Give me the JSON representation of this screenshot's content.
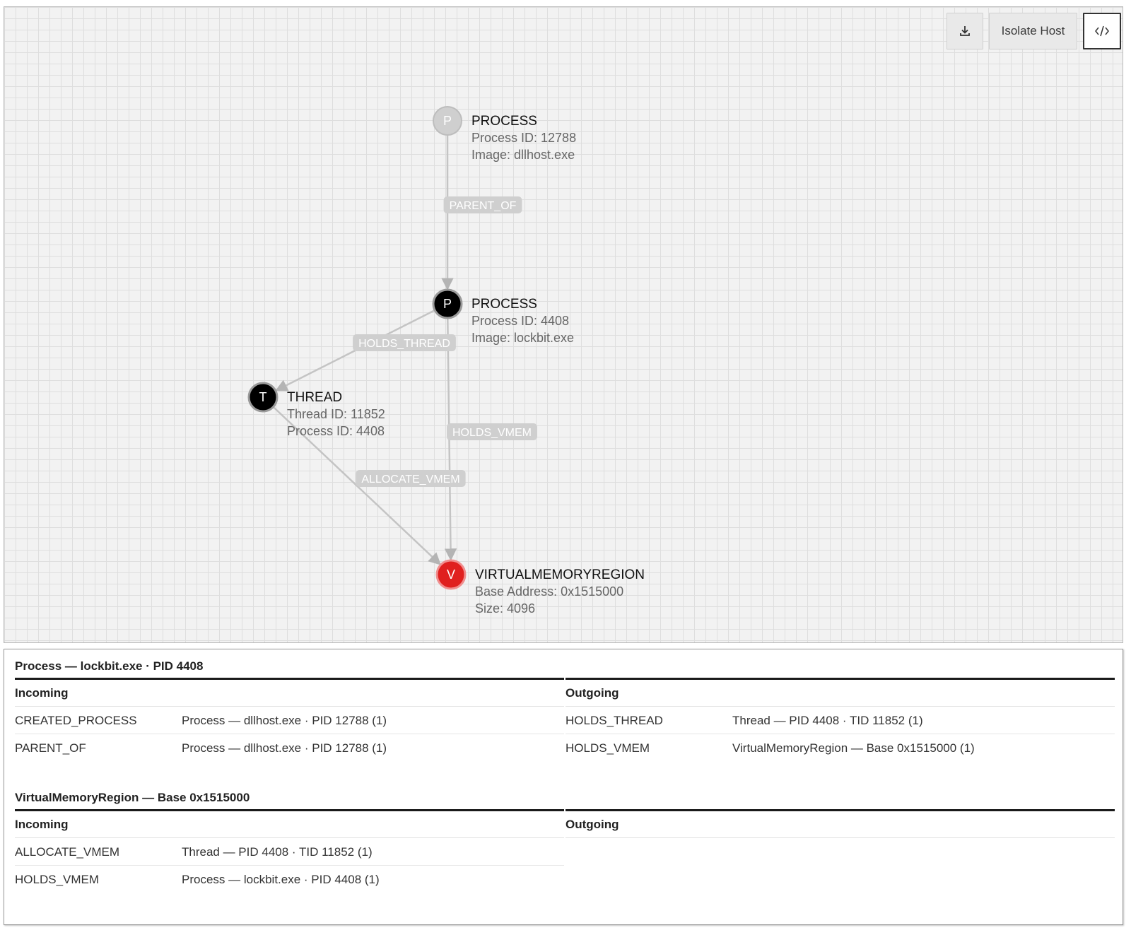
{
  "toolbar": {
    "download_icon": "download-icon",
    "isolate_label": "Isolate Host",
    "code_icon": "code-icon"
  },
  "graph": {
    "nodes": [
      {
        "id": "p1",
        "letter": "P",
        "type": "PROCESS",
        "line1": "Process ID: 12788",
        "line2": "Image: dllhost.exe",
        "color": "#cfcfcf"
      },
      {
        "id": "p2",
        "letter": "P",
        "type": "PROCESS",
        "line1": "Process ID: 4408",
        "line2": "Image: lockbit.exe",
        "color": "#000000"
      },
      {
        "id": "t1",
        "letter": "T",
        "type": "THREAD",
        "line1": "Thread ID: 11852",
        "line2": "Process ID: 4408",
        "color": "#000000"
      },
      {
        "id": "v1",
        "letter": "V",
        "type": "VIRTUALMEMORYREGION",
        "line1": "Base Address: 0x1515000",
        "line2": "Size: 4096",
        "color": "#e0201f"
      }
    ],
    "edges": [
      {
        "from": "p1",
        "to": "p2",
        "label": "PARENT_OF"
      },
      {
        "from": "p2",
        "to": "t1",
        "label": "HOLDS_THREAD"
      },
      {
        "from": "p2",
        "to": "v1",
        "label": "HOLDS_VMEM"
      },
      {
        "from": "t1",
        "to": "v1",
        "label": "ALLOCATE_VMEM"
      }
    ]
  },
  "details": {
    "sections": [
      {
        "title": "Process — lockbit.exe · PID 4408",
        "incoming_label": "Incoming",
        "outgoing_label": "Outgoing",
        "incoming": [
          {
            "type": "CREATED_PROCESS",
            "target": "Process — dllhost.exe · PID 12788 (1)"
          },
          {
            "type": "PARENT_OF",
            "target": "Process — dllhost.exe · PID 12788 (1)"
          }
        ],
        "outgoing": [
          {
            "type": "HOLDS_THREAD",
            "target": "Thread — PID 4408 · TID 11852 (1)"
          },
          {
            "type": "HOLDS_VMEM",
            "target": "VirtualMemoryRegion — Base 0x1515000 (1)"
          }
        ]
      },
      {
        "title": "VirtualMemoryRegion — Base 0x1515000",
        "incoming_label": "Incoming",
        "outgoing_label": "Outgoing",
        "incoming": [
          {
            "type": "ALLOCATE_VMEM",
            "target": "Thread — PID 4408 · TID 11852 (1)"
          },
          {
            "type": "HOLDS_VMEM",
            "target": "Process — lockbit.exe · PID 4408 (1)"
          }
        ],
        "outgoing": []
      }
    ]
  }
}
